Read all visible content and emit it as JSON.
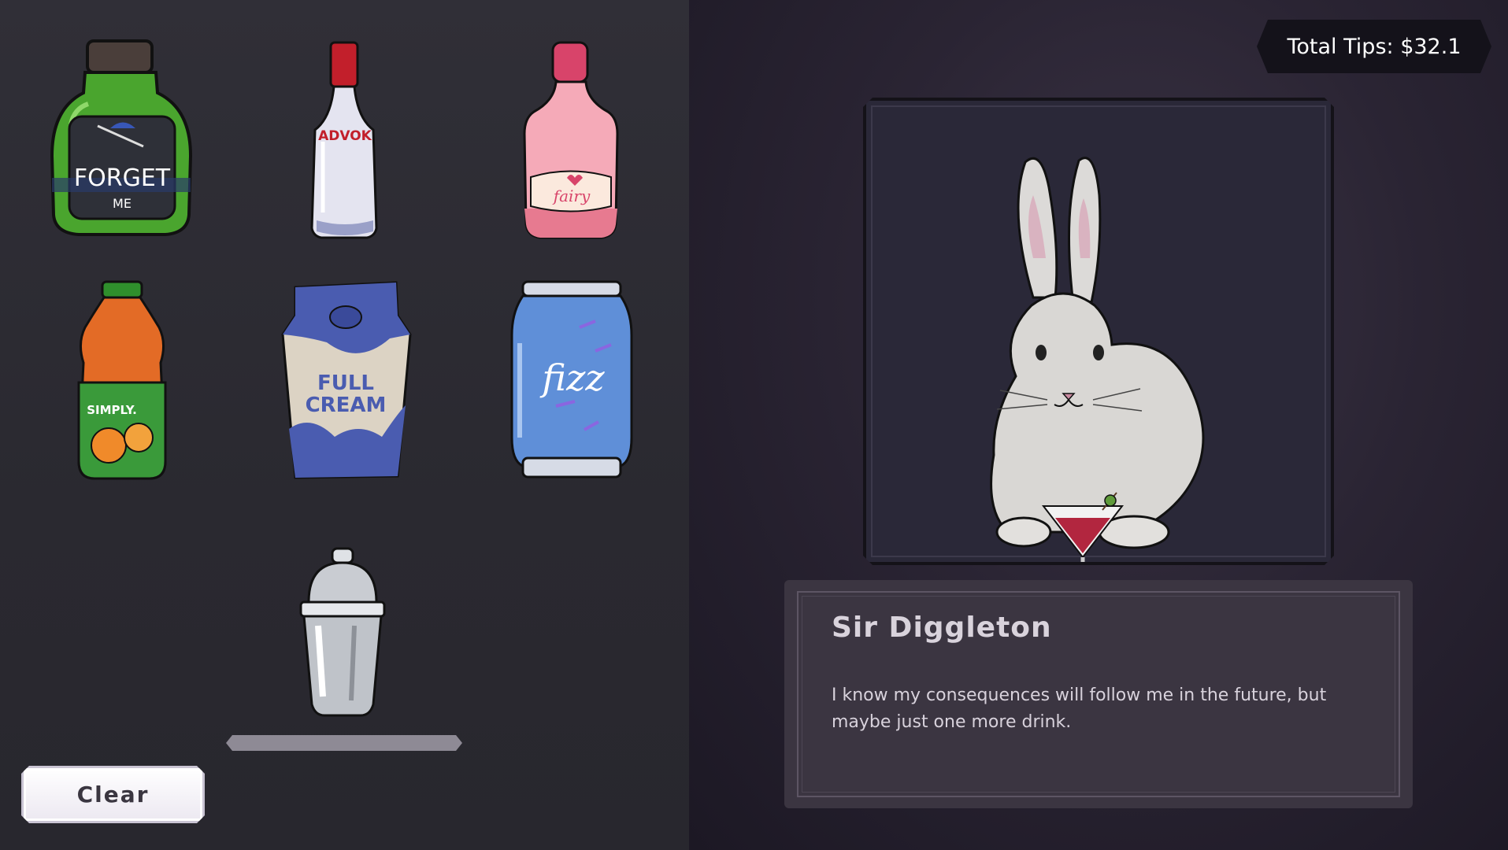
{
  "hud": {
    "tips_label": "Total Tips:",
    "tips_value": "$32.1"
  },
  "ingredients": [
    {
      "name": "forget-me",
      "label_line1": "FORGET",
      "label_line2": "ME"
    },
    {
      "name": "advok",
      "label": "ADVOK"
    },
    {
      "name": "fairy",
      "label": "fairy"
    },
    {
      "name": "simply",
      "label": "SIMPLY."
    },
    {
      "name": "full-cream",
      "label_line1": "FULL",
      "label_line2": "CREAM"
    },
    {
      "name": "fizz",
      "label": "fizz"
    }
  ],
  "shaker": {
    "fill_fraction": 0
  },
  "controls": {
    "clear_label": "Clear"
  },
  "customer": {
    "name": "Sir Diggleton",
    "dialogue": "I know my consequences will follow me in the future, but maybe just one more drink."
  },
  "colors": {
    "left_bg": "#2d2c33",
    "right_bg": "#2a2433",
    "dialogue_bg": "#3b3541",
    "tips_bg": "#14121a"
  }
}
